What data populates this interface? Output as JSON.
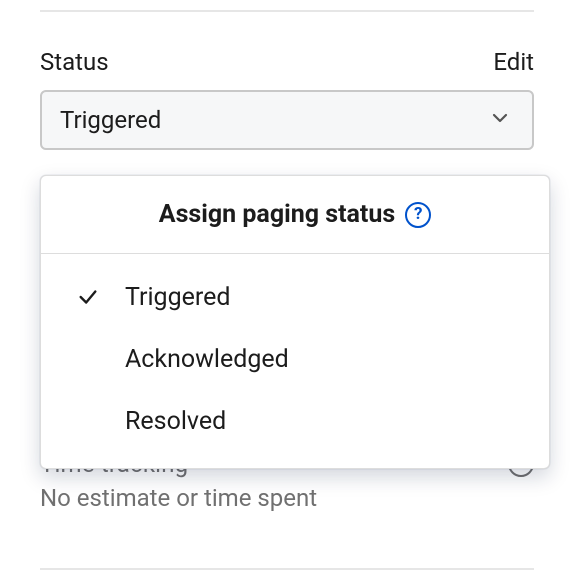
{
  "status_field": {
    "label": "Status",
    "edit_label": "Edit",
    "selected_value": "Triggered"
  },
  "dropdown": {
    "title": "Assign paging status",
    "help_glyph": "?",
    "options": [
      {
        "label": "Triggered",
        "selected": true
      },
      {
        "label": "Acknowledged",
        "selected": false
      },
      {
        "label": "Resolved",
        "selected": false
      }
    ]
  },
  "time_tracking": {
    "title": "Time tracking",
    "help_glyph": "?",
    "subtitle": "No estimate or time spent"
  }
}
